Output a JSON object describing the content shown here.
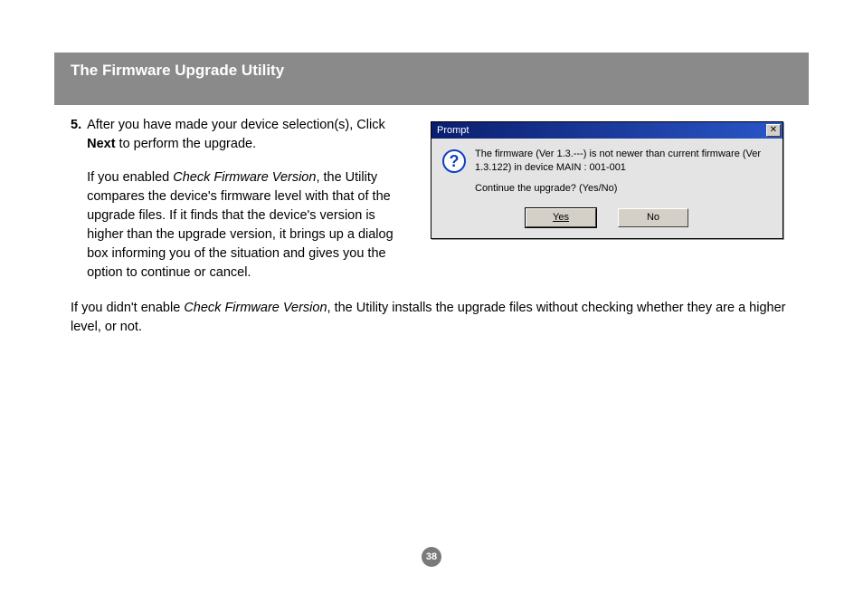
{
  "header": {
    "title": "The Firmware Upgrade Utility"
  },
  "step": {
    "number": "5.",
    "p1_a": "After you have made your device selection(s), Click ",
    "p1_bold": "Next",
    "p1_b": " to perform the upgrade.",
    "p2_a": "If you enabled ",
    "p2_italic": "Check Firmware Version",
    "p2_b": ", the Utility compares the device's firmware level with that of the upgrade files. If it finds that the device's version is higher than the upgrade version, it brings up a dialog box informing you of the situation and gives you the option to continue or cancel."
  },
  "dialog": {
    "title": "Prompt",
    "close": "✕",
    "line1": "The firmware (Ver 1.3.---) is not newer than current firmware (Ver 1.3.122) in device MAIN : 001-001",
    "line2": "Continue the upgrade? (Yes/No)",
    "yes": "Yes",
    "no": "No",
    "qmark": "?"
  },
  "bottom": {
    "a": "If you didn't enable ",
    "italic": "Check Firmware Version",
    "b": ", the Utility installs the upgrade files without checking whether they are a higher level, or not."
  },
  "page": "38"
}
